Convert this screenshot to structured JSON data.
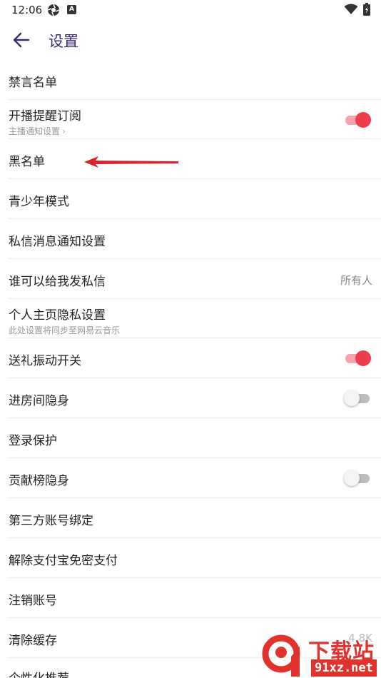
{
  "status_bar": {
    "time": "12:06",
    "icons": [
      "aperture-icon",
      "a-badge-icon",
      "wifi-icon",
      "battery-icon"
    ]
  },
  "app_bar": {
    "title": "设置",
    "title_color": "#3d2a7a"
  },
  "rows": {
    "mute_list": {
      "label": "禁言名单"
    },
    "live_reminder": {
      "label": "开播提醒订阅",
      "sub": "主播通知设置",
      "toggle": "on"
    },
    "blacklist": {
      "label": "黑名单"
    },
    "teen_mode": {
      "label": "青少年模式"
    },
    "dm_notify": {
      "label": "私信消息通知设置"
    },
    "who_dm": {
      "label": "谁可以给我发私信",
      "value": "所有人"
    },
    "privacy": {
      "label": "个人主页隐私设置",
      "sub": "此处设置将同步至网易云音乐"
    },
    "gift_vibrate": {
      "label": "送礼振动开关",
      "toggle": "on"
    },
    "room_hide": {
      "label": "进房间隐身",
      "toggle": "off"
    },
    "login_protect": {
      "label": "登录保护"
    },
    "rank_hide": {
      "label": "贡献榜隐身",
      "toggle": "off"
    },
    "third_party": {
      "label": "第三方账号绑定"
    },
    "alipay": {
      "label": "解除支付宝免密支付"
    },
    "delete_account": {
      "label": "注销账号"
    },
    "clear_cache": {
      "label": "清除缓存",
      "value": "4.8K"
    },
    "personalize": {
      "label": "个性化推荐"
    }
  },
  "colors": {
    "toggle_on_knob": "#ee3d4d",
    "toggle_on_track": "#f6a3ab",
    "toggle_off_track": "#bdbdbd",
    "annotation_arrow": "#d9232d",
    "watermark_red": "#e0332e"
  },
  "watermark": {
    "brand": "下载站",
    "url": "91xz.net",
    "logo_digit": "9"
  }
}
